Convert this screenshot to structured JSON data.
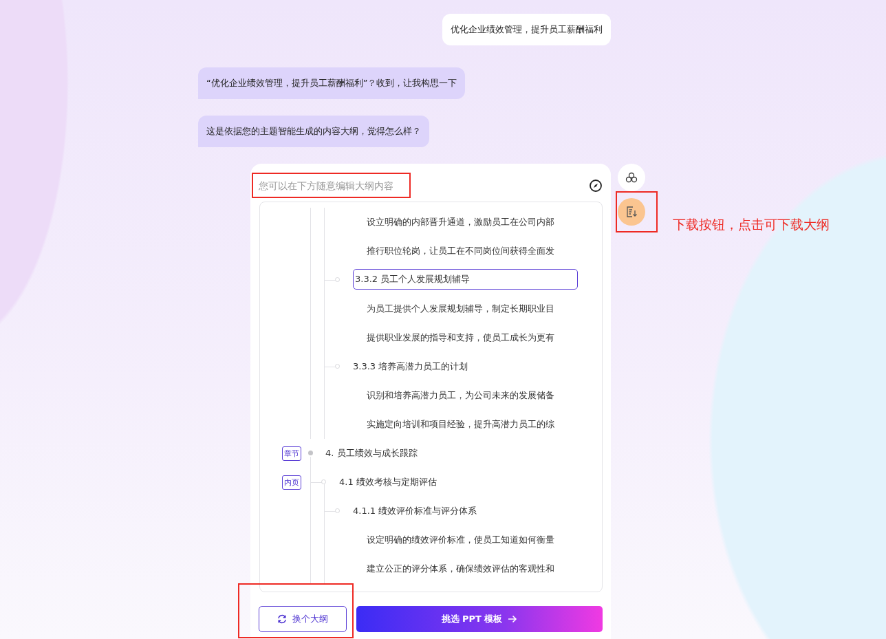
{
  "messages": [
    {
      "kind": "outgoing",
      "text": "优化企业绩效管理，提升员工薪酬福利"
    },
    {
      "kind": "incoming",
      "text": "“优化企业绩效管理，提升员工薪酬福利”？收到，让我构思一下"
    },
    {
      "kind": "incoming",
      "text": "这是依据您的主题智能生成的内容大纲，觉得怎么样？"
    }
  ],
  "outline": {
    "placeholder": "您可以在下方随意编辑大纲内容",
    "items": [
      {
        "kind": "point",
        "text": "设立明确的内部晋升通道，激励员工在公司内部",
        "selected": false
      },
      {
        "kind": "point",
        "text": "推行职位轮岗，让员工在不同岗位间获得全面发",
        "selected": false
      },
      {
        "kind": "sub",
        "text": "3.3.2 员工个人发展规划辅导",
        "selected": true
      },
      {
        "kind": "point",
        "text": "为员工提供个人发展规划辅导，制定长期职业目",
        "selected": false
      },
      {
        "kind": "point",
        "text": "提供职业发展的指导和支持，使员工成长为更有",
        "selected": false
      },
      {
        "kind": "sub",
        "text": "3.3.3 培养高潜力员工的计划",
        "selected": false
      },
      {
        "kind": "point",
        "text": "识别和培养高潜力员工，为公司未来的发展储备",
        "selected": false
      },
      {
        "kind": "point",
        "text": "实施定向培训和项目经验，提升高潜力员工的综",
        "selected": false
      },
      {
        "kind": "chapter",
        "badge": "章节",
        "text": "4. 员工绩效与成长跟踪",
        "selected": false
      },
      {
        "kind": "section",
        "badge": "内页",
        "text": "4.1 绩效考核与定期评估",
        "selected": false
      },
      {
        "kind": "sub",
        "text": "4.1.1 绩效评价标准与评分体系",
        "selected": false
      },
      {
        "kind": "point",
        "text": "设定明确的绩效评价标准，使员工知道如何衡量",
        "selected": false
      },
      {
        "kind": "point",
        "text": "建立公正的评分体系，确保绩效评估的客观性和",
        "selected": false
      }
    ]
  },
  "buttons": {
    "regenerate": "换个大纲",
    "choose_template": "挑选 PPT 模板"
  },
  "annotation": {
    "caption": "下载按钮，点击可下载大纲"
  }
}
